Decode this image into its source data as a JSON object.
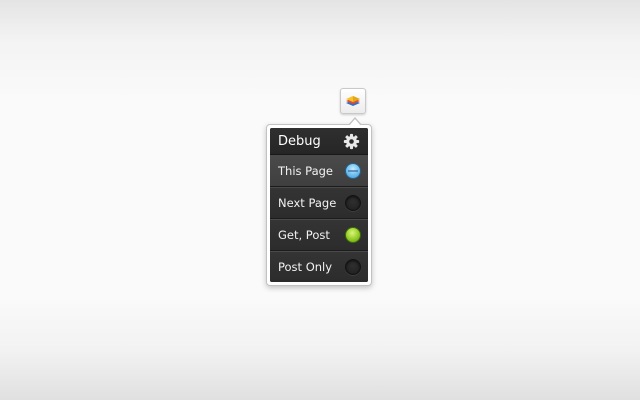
{
  "toggle": {
    "icon": "stacked-layers-icon"
  },
  "menu": {
    "title": "Debug",
    "settings_icon": "gear-icon",
    "items": [
      {
        "label": "This Page",
        "state": "selected",
        "indicator_color": "#5fb4ea"
      },
      {
        "label": "Next Page",
        "state": "off",
        "indicator_color": "#222222"
      },
      {
        "label": "Get, Post",
        "state": "on",
        "indicator_color": "#8cc63f"
      },
      {
        "label": "Post Only",
        "state": "off",
        "indicator_color": "#222222"
      }
    ]
  }
}
